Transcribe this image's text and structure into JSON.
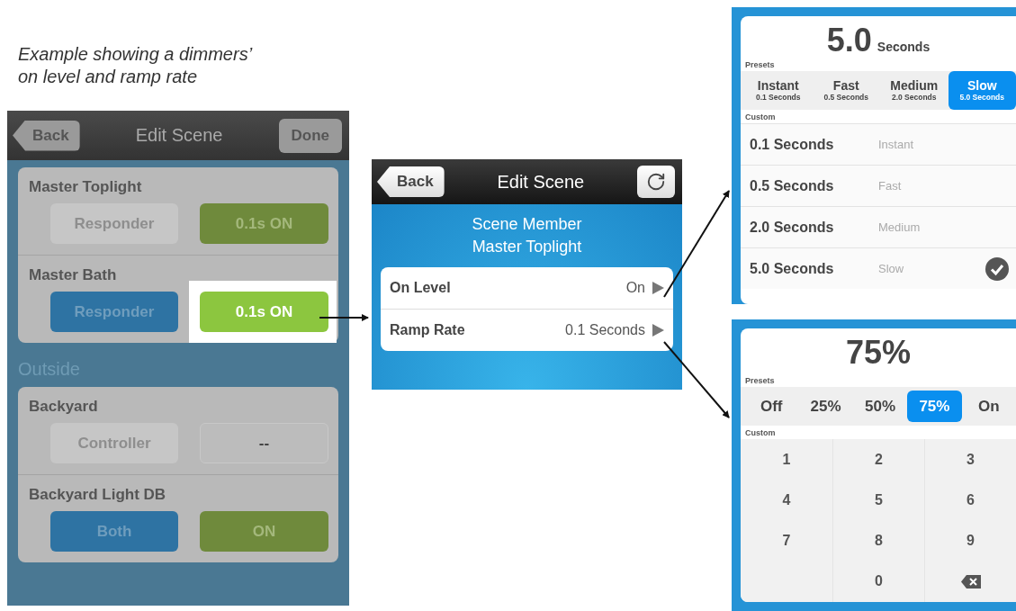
{
  "caption": [
    "Example showing a dimmers’",
    "on level and ramp rate"
  ],
  "scene_list": {
    "back": "Back",
    "title": "Edit Scene",
    "done": "Done",
    "groups": [
      {
        "members": [
          {
            "name": "Master Toplight",
            "role": {
              "label": "Responder",
              "kind": "disabled"
            },
            "state": {
              "label": "0.1s  ON",
              "kind": "on",
              "highlighted": false
            }
          },
          {
            "name": "Master Bath",
            "role": {
              "label": "Responder",
              "kind": "active"
            },
            "state": {
              "label": "0.1s  ON",
              "kind": "on",
              "highlighted": true
            }
          }
        ]
      },
      {
        "heading": "Outside",
        "members": [
          {
            "name": "Backyard",
            "role": {
              "label": "Controller",
              "kind": "disabled"
            },
            "state": {
              "label": "--",
              "kind": "empty",
              "highlighted": false
            }
          },
          {
            "name": "Backyard Light DB",
            "role": {
              "label": "Both",
              "kind": "active"
            },
            "state": {
              "label": "ON",
              "kind": "on",
              "highlighted": false
            }
          }
        ]
      }
    ]
  },
  "member_editor": {
    "back": "Back",
    "title": "Edit Scene",
    "subtitle": [
      "Scene Member",
      "Master Toplight"
    ],
    "rows": [
      {
        "label": "On Level",
        "value": "On"
      },
      {
        "label": "Ramp Rate",
        "value": "0.1 Seconds"
      }
    ]
  },
  "ramp_picker": {
    "value": "5.0",
    "unit": "Seconds",
    "presets_label": "Presets",
    "presets": [
      {
        "name": "Instant",
        "detail": "0.1 Seconds",
        "selected": false
      },
      {
        "name": "Fast",
        "detail": "0.5 Seconds",
        "selected": false
      },
      {
        "name": "Medium",
        "detail": "2.0 Seconds",
        "selected": false
      },
      {
        "name": "Slow",
        "detail": "5.0 Seconds",
        "selected": true
      }
    ],
    "custom_label": "Custom",
    "options": [
      {
        "value": "0.1 Seconds",
        "name": "Instant",
        "checked": false
      },
      {
        "value": "0.5 Seconds",
        "name": "Fast",
        "checked": false
      },
      {
        "value": "2.0 Seconds",
        "name": "Medium",
        "checked": false
      },
      {
        "value": "5.0 Seconds",
        "name": "Slow",
        "checked": true
      }
    ]
  },
  "level_picker": {
    "value": "75%",
    "presets_label": "Presets",
    "presets": [
      {
        "label": "Off",
        "selected": false
      },
      {
        "label": "25%",
        "selected": false
      },
      {
        "label": "50%",
        "selected": false
      },
      {
        "label": "75%",
        "selected": true
      },
      {
        "label": "On",
        "selected": false
      }
    ],
    "custom_label": "Custom",
    "keys": [
      {
        "kind": "digit",
        "label": "1"
      },
      {
        "kind": "digit",
        "label": "2"
      },
      {
        "kind": "digit",
        "label": "3"
      },
      {
        "kind": "digit",
        "label": "4"
      },
      {
        "kind": "digit",
        "label": "5"
      },
      {
        "kind": "digit",
        "label": "6"
      },
      {
        "kind": "digit",
        "label": "7"
      },
      {
        "kind": "digit",
        "label": "8"
      },
      {
        "kind": "digit",
        "label": "9"
      },
      {
        "kind": "blank"
      },
      {
        "kind": "digit",
        "label": "0"
      },
      {
        "kind": "backspace"
      }
    ]
  }
}
